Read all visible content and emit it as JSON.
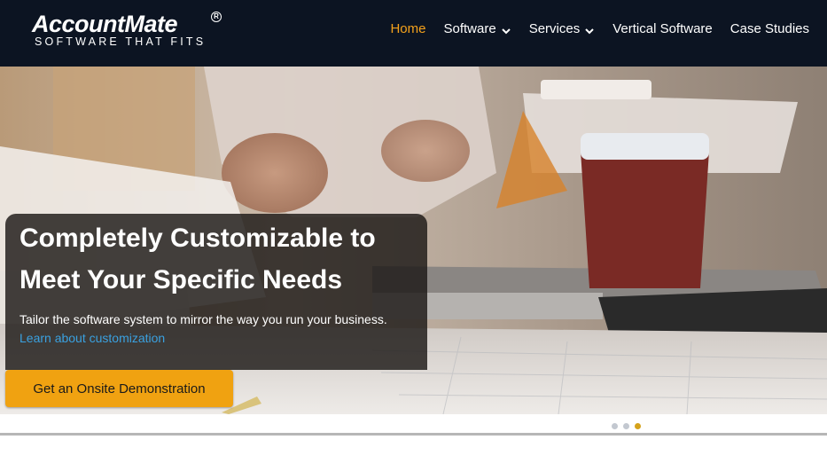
{
  "brand": {
    "name": "AccountMate",
    "registered": "R",
    "tagline": "SOFTWARE THAT FITS"
  },
  "nav": {
    "items": [
      {
        "label": "Home",
        "active": true,
        "dropdown": false
      },
      {
        "label": "Software",
        "active": false,
        "dropdown": true
      },
      {
        "label": "Services",
        "active": false,
        "dropdown": true
      },
      {
        "label": "Vertical Software",
        "active": false,
        "dropdown": false
      },
      {
        "label": "Case Studies",
        "active": false,
        "dropdown": false
      }
    ],
    "active_color": "#f5a21c"
  },
  "hero": {
    "title": "Completely Customizable to Meet Your Specific Needs",
    "description": "Tailor the software system to mirror the way you run your business.",
    "link_text": "Learn about customization",
    "cta_label": "Get an Onsite Demonstration",
    "cta_color": "#f0a211",
    "link_color": "#3aa1e0"
  },
  "slider": {
    "slide_count": 3,
    "active_index": 2
  },
  "colors": {
    "header_bg": "#0c1422",
    "accent": "#f5a21c"
  }
}
